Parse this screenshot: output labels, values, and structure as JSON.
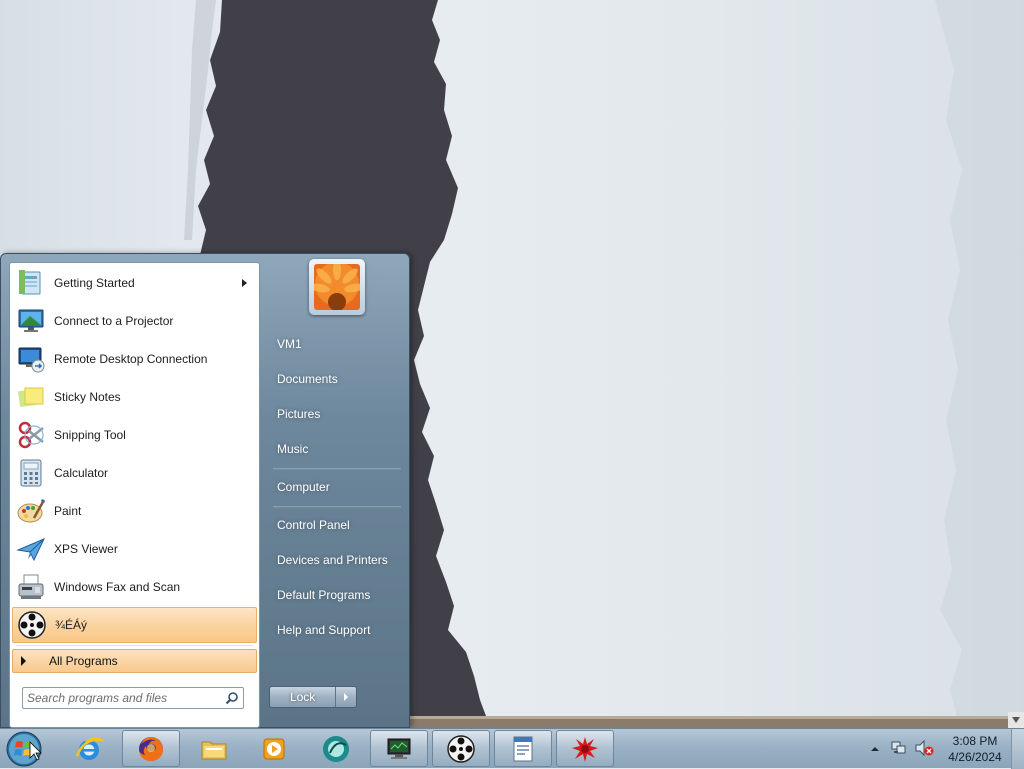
{
  "start_menu": {
    "programs": [
      {
        "label": "Getting Started",
        "icon": "getting-started-icon",
        "has_submenu": true
      },
      {
        "label": "Connect to a Projector",
        "icon": "projector-icon"
      },
      {
        "label": "Remote Desktop Connection",
        "icon": "remote-desktop-icon"
      },
      {
        "label": "Sticky Notes",
        "icon": "sticky-notes-icon"
      },
      {
        "label": "Snipping Tool",
        "icon": "scissors-icon"
      },
      {
        "label": "Calculator",
        "icon": "calculator-icon"
      },
      {
        "label": "Paint",
        "icon": "paint-palette-icon"
      },
      {
        "label": "XPS Viewer",
        "icon": "xps-viewer-icon"
      },
      {
        "label": "Windows Fax and Scan",
        "icon": "fax-icon"
      },
      {
        "label": "¾ÉÁý",
        "icon": "film-reel-icon",
        "highlighted": true
      }
    ],
    "all_programs_label": "All Programs",
    "search_placeholder": "Search programs and files",
    "right_links": [
      "VM1",
      "Documents",
      "Pictures",
      "Music",
      "Computer",
      "Control Panel",
      "Devices and Printers",
      "Default Programs",
      "Help and Support"
    ],
    "lock_label": "Lock"
  },
  "taskbar": {
    "items": [
      "start-orb-icon",
      "internet-explorer-icon",
      "firefox-icon",
      "file-explorer-icon",
      "media-player-icon",
      "app-circle-icon",
      "monitor-app-icon",
      "film-reel-icon",
      "document-app-icon",
      "red-splat-icon"
    ],
    "clock_time": "3:08 PM",
    "clock_date": "4/26/2024"
  },
  "colors": {
    "accent_highlight": "#fbd3a0",
    "start_menu_right": "#6d879c",
    "taskbar": "#9bb2c5",
    "wallpaper_dark": "#414049"
  }
}
